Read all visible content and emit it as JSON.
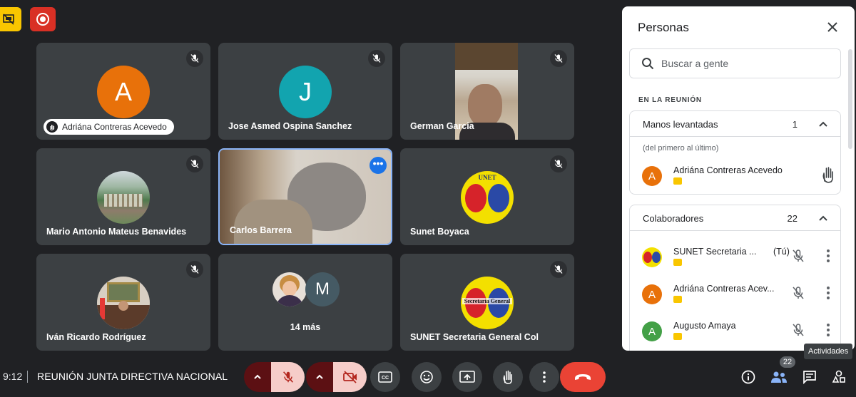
{
  "badges": {
    "yellow_icon": "present-off-icon",
    "red_icon": "record-icon"
  },
  "tiles": [
    {
      "name": "Adriána Contreras Acevedo",
      "initial": "A",
      "color": "#e8710a",
      "hand_raised": true
    },
    {
      "name": "Jose Asmed Ospina Sanchez",
      "initial": "J",
      "color": "#12a4af"
    },
    {
      "name": "German Garcia"
    },
    {
      "name": "Mario Antonio Mateus Benavides"
    },
    {
      "name": "Carlos Barrera"
    },
    {
      "name": "Sunet Boyaca",
      "logo_text": "UNET"
    },
    {
      "name": "Iván Ricardo Rodríguez"
    },
    {
      "more_label": "14 más",
      "initial": "M",
      "color": "#455a64"
    },
    {
      "name": "SUNET Secretaria General Col",
      "logo_text": "Secretaría General"
    }
  ],
  "bottom": {
    "time": "9:12",
    "title": "REUNIÓN JUNTA DIRECTIVA NACIONAL",
    "people_count": "22",
    "tooltip": "Actividades"
  },
  "panel": {
    "title": "Personas",
    "search_placeholder": "Buscar a gente",
    "section": "EN LA REUNIÓN",
    "raised": {
      "label": "Manos levantadas",
      "count": "1",
      "note": "(del primero al último)",
      "people": [
        {
          "name": "Adriána Contreras Acevedo",
          "initial": "A",
          "color": "#e8710a"
        }
      ]
    },
    "collaborators": {
      "label": "Colaboradores",
      "count": "22",
      "people": [
        {
          "name": "SUNET Secretaria ...",
          "suffix": "(Tú)"
        },
        {
          "name": "Adriána Contreras Acev...",
          "initial": "A",
          "color": "#e8710a"
        },
        {
          "name": "Augusto Amaya",
          "initial": "A",
          "color": "#43a047"
        }
      ]
    }
  }
}
